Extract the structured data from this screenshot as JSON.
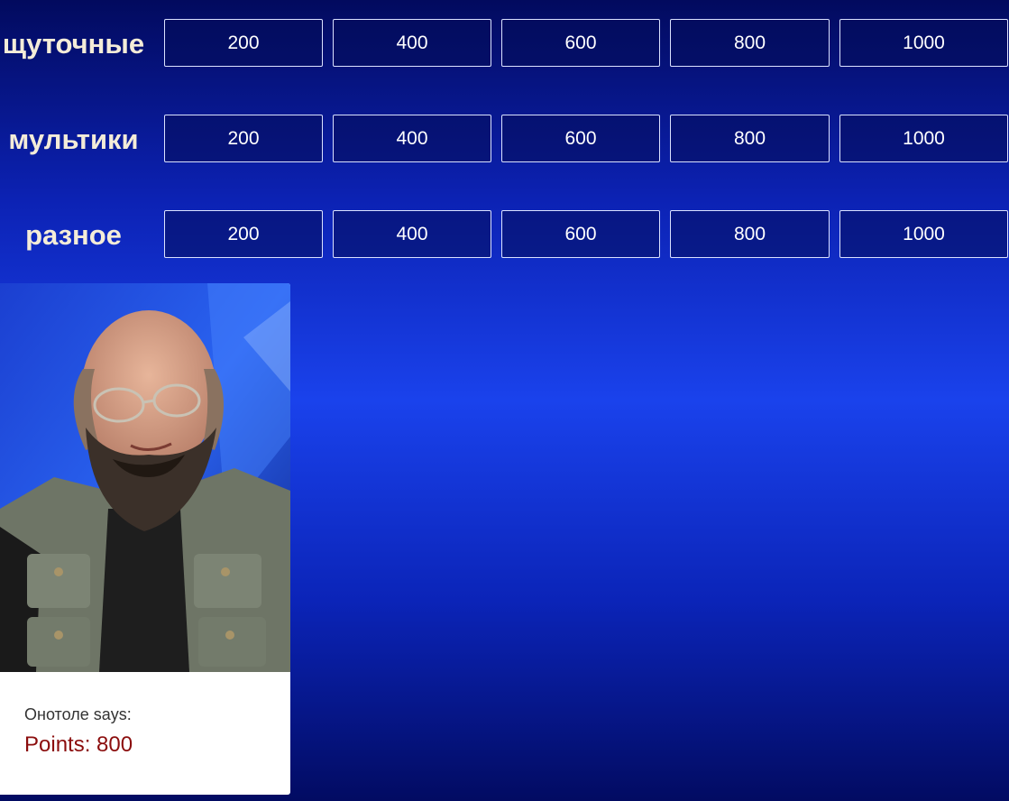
{
  "board": {
    "categories": [
      {
        "name": "щуточные",
        "values": [
          "200",
          "400",
          "600",
          "800",
          "1000"
        ]
      },
      {
        "name": "мультики",
        "values": [
          "200",
          "400",
          "600",
          "800",
          "1000"
        ]
      },
      {
        "name": "разное",
        "values": [
          "200",
          "400",
          "600",
          "800",
          "1000"
        ]
      }
    ]
  },
  "host_card": {
    "says_label": "Онотоле says:",
    "points_label": "Points: 800",
    "photo_icon": "bearded-man-portrait"
  },
  "colors": {
    "background_top": "#020a5e",
    "background_mid": "#1a42ec",
    "cell_border": "#dbe2ff",
    "category_text": "#f4ecd8",
    "points_text": "#8b0d0d"
  }
}
